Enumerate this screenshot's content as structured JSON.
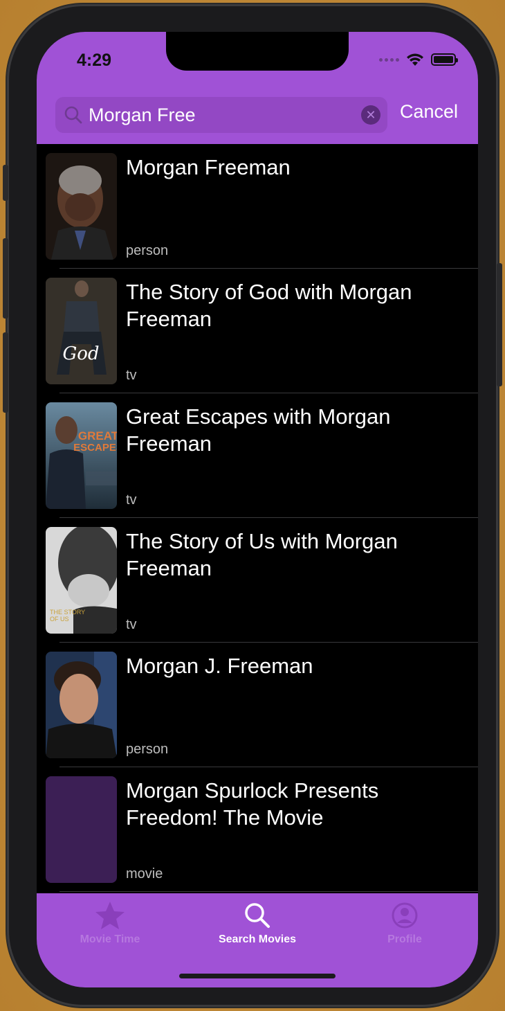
{
  "status_bar": {
    "time": "4:29"
  },
  "search": {
    "query": "Morgan Free",
    "clear_icon": "clear-circle-icon",
    "cancel_label": "Cancel"
  },
  "results": [
    {
      "title": "Morgan Freeman",
      "kind": "person"
    },
    {
      "title": "The Story of God with Morgan Freeman",
      "kind": "tv"
    },
    {
      "title": "Great Escapes with Morgan Freeman",
      "kind": "tv"
    },
    {
      "title": "The Story of Us with Morgan Freeman",
      "kind": "tv"
    },
    {
      "title": "Morgan J. Freeman",
      "kind": "person"
    },
    {
      "title": "Morgan Spurlock Presents Freedom! The Movie",
      "kind": "movie"
    }
  ],
  "tab_bar": {
    "tabs": [
      {
        "label": "Movie Time",
        "icon": "star-icon"
      },
      {
        "label": "Search Movies",
        "icon": "search-icon"
      },
      {
        "label": "Profile",
        "icon": "profile-icon"
      }
    ],
    "active": "Search Movies"
  },
  "colors": {
    "accent": "#a052d6",
    "background": "#000000",
    "placeholder_poster": "#3c1f55"
  }
}
